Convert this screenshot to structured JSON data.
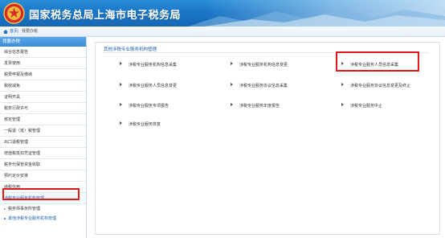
{
  "header": {
    "title": "国家税务总局上海市电子税务局",
    "emblem": "tax-emblem-icon",
    "colors": {
      "banner": "#1a76c7",
      "text": "#ffffff"
    }
  },
  "breadcrumb": {
    "home": "首页",
    "separator": "|",
    "current": "我要办税"
  },
  "sidebar": {
    "header": "我要办税",
    "items": [
      {
        "label": "综合信息报告"
      },
      {
        "label": "发票使用"
      },
      {
        "label": "税费申报及缴纳"
      },
      {
        "label": "税收减免"
      },
      {
        "label": "证明开具"
      },
      {
        "label": "税务行政许可"
      },
      {
        "label": "核定管理"
      },
      {
        "label": "一般退（抵）税管理"
      },
      {
        "label": "出口退税管理"
      },
      {
        "label": "增值税抵扣凭证管理"
      },
      {
        "label": "税务代保管资金收取"
      },
      {
        "label": "预约定价安排"
      },
      {
        "label": "纳税信用"
      },
      {
        "label": "涉税专业服务机构管理"
      }
    ],
    "sub_items": [
      {
        "label": "税务师事务所管理"
      },
      {
        "label": "其他涉税专业服务机构管理"
      }
    ],
    "active_color": "#1f5fa8",
    "highlight_color": "#e01818"
  },
  "main": {
    "panel_title": "其他涉税专业服务机构管理",
    "services": [
      {
        "label": "涉税专业服务机构信息采集"
      },
      {
        "label": "涉税专业服务机构信息变更"
      },
      {
        "label": "涉税专业服务人员信息采集"
      },
      {
        "label": "涉税专业服务人员信息变更"
      },
      {
        "label": "涉税专业服务协议信息采集"
      },
      {
        "label": "涉税专业服务协议信息变更及终止"
      },
      {
        "label": "涉税专业服务专项报告"
      },
      {
        "label": "涉税专业服务年度报告"
      },
      {
        "label": "涉税专业服务中止"
      },
      {
        "label": "涉税专业服务恢复"
      }
    ],
    "highlight_color": "#e01818"
  }
}
